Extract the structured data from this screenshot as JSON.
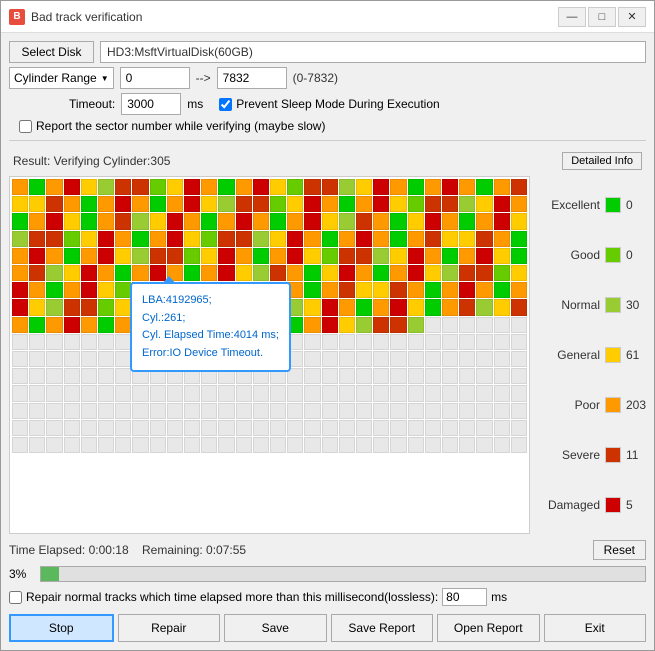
{
  "window": {
    "title": "Bad track verification",
    "icon": "B"
  },
  "titlebar": {
    "minimize": "—",
    "maximize": "□",
    "close": "✕"
  },
  "toolbar": {
    "select_disk_label": "Select Disk",
    "disk_name": "HD3:MsftVirtualDisk(60GB)",
    "range_label": "Cylinder Range",
    "range_start": "0",
    "arrow": "-->",
    "range_end": "7832",
    "range_info": "(0-7832)",
    "timeout_label": "Timeout:",
    "timeout_value": "3000",
    "timeout_unit": "ms",
    "prevent_sleep_label": "Prevent Sleep Mode During Execution",
    "report_sector_label": "Report the sector number while verifying (maybe slow)"
  },
  "result": {
    "text": "Result:  Verifying Cylinder:305",
    "detailed_info_label": "Detailed Info"
  },
  "tooltip": {
    "line1": "LBA:4192965;",
    "line2": "Cyl.:261;",
    "line3": "Cyl. Elapsed Time:4014 ms;",
    "line4": "Error:IO Device Timeout."
  },
  "legend": {
    "items": [
      {
        "label": "Excellent",
        "color": "#00cc00",
        "count": "0"
      },
      {
        "label": "Good",
        "color": "#66cc00",
        "count": "0"
      },
      {
        "label": "Normal",
        "color": "#99cc33",
        "count": "30"
      },
      {
        "label": "General",
        "color": "#ffcc00",
        "count": "61"
      },
      {
        "label": "Poor",
        "color": "#ff9900",
        "count": "203"
      },
      {
        "label": "Severe",
        "color": "#cc3300",
        "count": "11"
      },
      {
        "label": "Damaged",
        "color": "#cc0000",
        "count": "5"
      }
    ]
  },
  "timing": {
    "time_elapsed_label": "Time Elapsed:",
    "time_elapsed": "0:00:18",
    "remaining_label": "Remaining:",
    "remaining": "0:07:55",
    "reset_label": "Reset"
  },
  "progress": {
    "percent": "3%",
    "bar_width": "3"
  },
  "repair": {
    "label1": "Repair normal tracks which time elapsed more than this millisecond(lossless):",
    "value": "80",
    "unit": "ms"
  },
  "buttons": {
    "stop": "Stop",
    "repair": "Repair",
    "save": "Save",
    "save_report": "Save Report",
    "open_report": "Open Report",
    "exit": "Exit"
  },
  "grid_colors": {
    "empty": "#f5f5f5",
    "excellent": "#00cc00",
    "good": "#66cc00",
    "normal": "#99cc33",
    "general": "#ffcc00",
    "poor": "#ff9900",
    "severe": "#cc3300",
    "damaged": "#cc0000",
    "unvisited": "#e8e8e8"
  }
}
